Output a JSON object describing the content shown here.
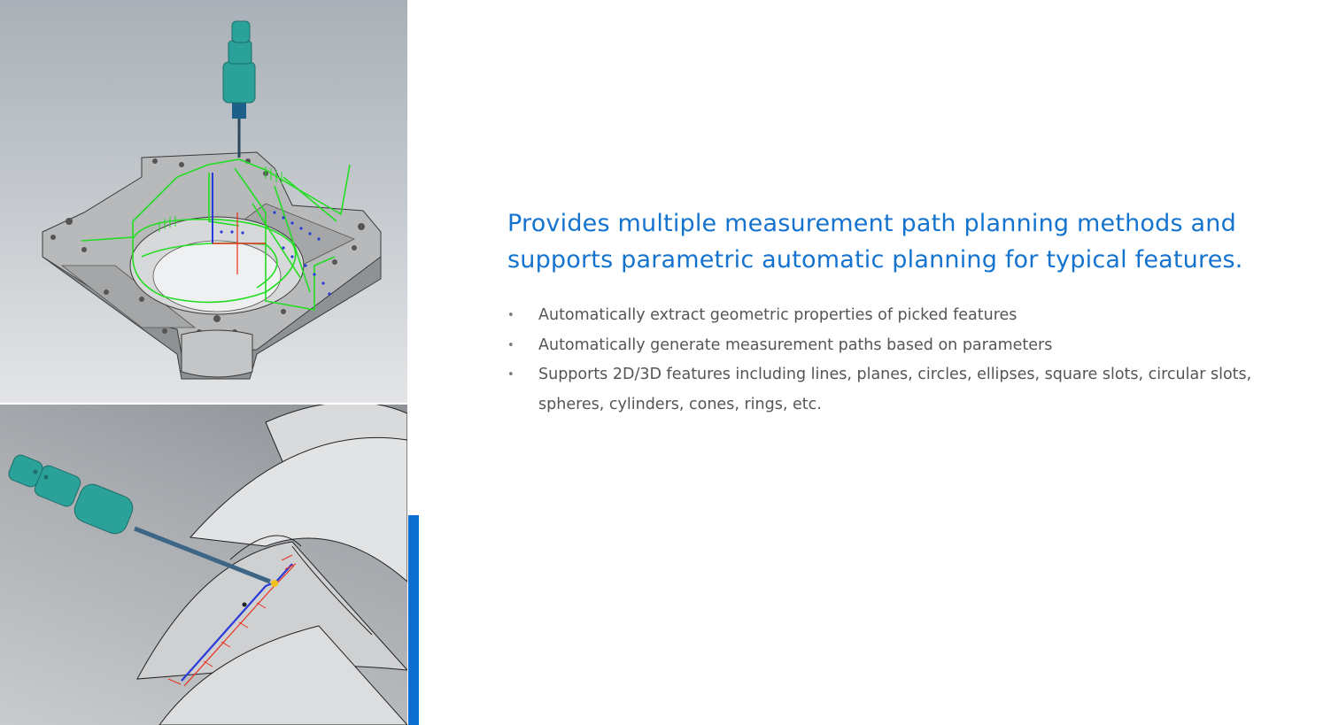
{
  "headline": "Provides multiple measurement path planning methods and supports parametric automatic planning for typical features.",
  "features": [
    "Automatically extract geometric properties of picked features",
    "Automatically generate measurement paths based on parameters",
    "Supports 2D/3D features including lines, planes, circles, ellipses, square slots, circular slots, spheres, cylinders, cones, rings, etc."
  ],
  "bullet_glyph": "•",
  "colors": {
    "headline": "#1473cf",
    "body_text": "#555555",
    "accent_bar": "#0a6fd0",
    "probe": "#2aa29a",
    "path_green": "#22dd22",
    "path_red": "#e8301f",
    "path_blue": "#2a3bd8"
  },
  "images": {
    "top": "cmm-probe-planning-path-on-housing-part",
    "bottom": "cmm-probe-measuring-turbine-blade-edge"
  }
}
